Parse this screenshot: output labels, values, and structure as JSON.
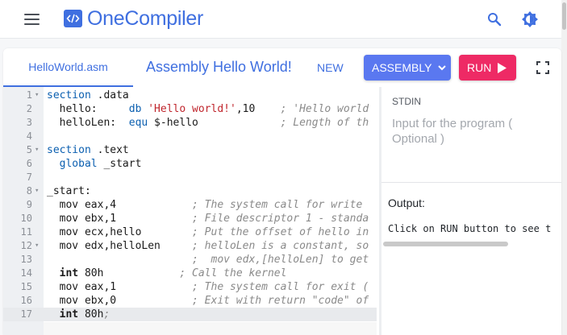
{
  "header": {
    "brand": "OneCompiler",
    "logo_glyph": "</>",
    "accent_color": "#3f6fe0"
  },
  "toolbar": {
    "file_tab": "HelloWorld.asm",
    "program_title": "Assembly Hello World!",
    "new_label": "NEW",
    "language_label": "ASSEMBLY",
    "run_label": "RUN",
    "language_color": "#5a78f0",
    "run_color": "#ee2a65"
  },
  "editor": {
    "active_line": 17,
    "lines": [
      {
        "n": "1",
        "fold": "▾"
      },
      {
        "n": "2"
      },
      {
        "n": "3"
      },
      {
        "n": "4"
      },
      {
        "n": "5",
        "fold": "▾"
      },
      {
        "n": "6"
      },
      {
        "n": "7"
      },
      {
        "n": "8",
        "fold": "▾"
      },
      {
        "n": "9"
      },
      {
        "n": "10"
      },
      {
        "n": "11"
      },
      {
        "n": "12",
        "fold": "▾"
      },
      {
        "n": "13"
      },
      {
        "n": "14"
      },
      {
        "n": "15"
      },
      {
        "n": "16"
      },
      {
        "n": "17"
      }
    ],
    "code": {
      "l1_kw": "section",
      "l1_rest": " .data",
      "l2_a": "  hello:     ",
      "l2_kw": "db",
      "l2_sp": " ",
      "l2_str": "'Hello world!'",
      "l2_rest": ",10    ",
      "l2_cm": "; 'Hello world",
      "l3_a": "  helloLen:  ",
      "l3_kw": "equ",
      "l3_rest": " $-hello             ",
      "l3_cm": "; Length of th",
      "l5_kw": "section",
      "l5_rest": " .text",
      "l6_a": "  ",
      "l6_kw": "global",
      "l6_rest": " _start",
      "l8": "_start:",
      "l9_a": "  mov eax,4            ",
      "l9_cm": "; The system call for write",
      "l10_a": "  mov ebx,1            ",
      "l10_cm": "; File descriptor 1 - standa",
      "l11_a": "  mov ecx,hello        ",
      "l11_cm": "; Put the offset of hello in",
      "l12_a": "  mov edx,helloLen     ",
      "l12_cm": "; helloLen is a constant, so",
      "l13_a": "                       ",
      "l13_cm": ";  mov edx,[helloLen] to get",
      "l14_a": "  ",
      "l14_kw": "int",
      "l14_b": " 80h            ",
      "l14_cm": "; Call the kernel",
      "l15_a": "  mov eax,1            ",
      "l15_cm": "; The system call for exit (",
      "l16_a": "  mov ebx,0            ",
      "l16_cm": "; Exit with return \"code\" of",
      "l17_a": "  ",
      "l17_kw": "int",
      "l17_b": " 80h",
      "l17_cursor": ";"
    }
  },
  "stdin": {
    "label": "STDIN",
    "placeholder": "Input for the program ( Optional )"
  },
  "output": {
    "label": "Output:",
    "text": "Click on RUN button to see t"
  }
}
